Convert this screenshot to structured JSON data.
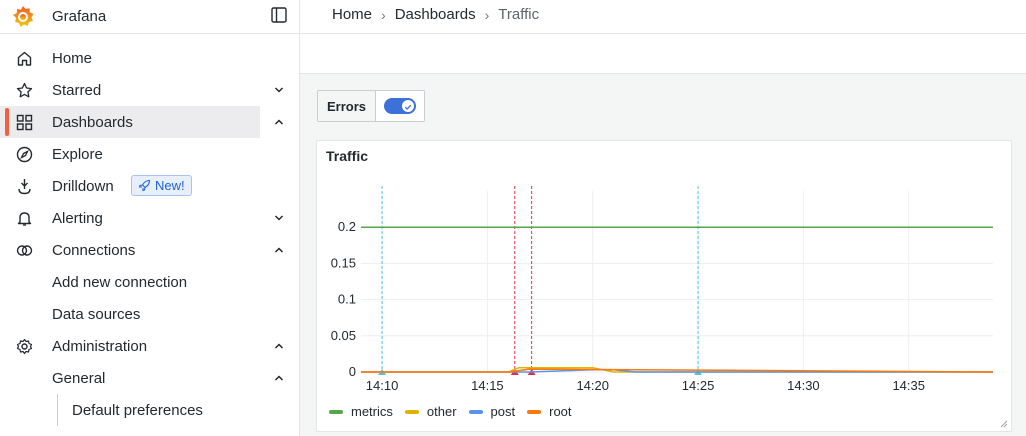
{
  "app": {
    "title": "Grafana"
  },
  "sidebar": {
    "items": [
      {
        "label": "Home",
        "icon": "home-icon"
      },
      {
        "label": "Starred",
        "icon": "star-icon",
        "chevron": "down"
      },
      {
        "label": "Dashboards",
        "icon": "apps-icon",
        "chevron": "up",
        "active": true
      },
      {
        "label": "Explore",
        "icon": "compass-icon"
      },
      {
        "label": "Drilldown",
        "icon": "drilldown-icon",
        "badge": "New!"
      },
      {
        "label": "Alerting",
        "icon": "bell-icon",
        "chevron": "down"
      },
      {
        "label": "Connections",
        "icon": "connections-icon",
        "chevron": "up"
      },
      {
        "label": "Add new connection"
      },
      {
        "label": "Data sources"
      },
      {
        "label": "Administration",
        "icon": "cog-icon",
        "chevron": "up"
      },
      {
        "label": "General",
        "chevron": "up"
      },
      {
        "label": "Default preferences"
      }
    ]
  },
  "breadcrumb": {
    "items": [
      "Home",
      "Dashboards",
      "Traffic"
    ]
  },
  "variable": {
    "label": "Errors",
    "enabled": true
  },
  "panel": {
    "title": "Traffic"
  },
  "colors": {
    "accent": "#f55f3e",
    "metrics": "#56a64b",
    "other": "#e0b400",
    "post": "#5794f2",
    "root": "#ff780a",
    "annotation_blue": "#4fc4e0",
    "annotation_red": "#e02f44"
  },
  "chart_data": {
    "type": "line",
    "title": "Traffic",
    "xlabel": "",
    "ylabel": "",
    "x_ticks": [
      "14:10",
      "14:15",
      "14:20",
      "14:25",
      "14:30",
      "14:35"
    ],
    "y_ticks": [
      "0",
      "0.05",
      "0.1",
      "0.15",
      "0.2"
    ],
    "ylim": [
      0,
      0.25
    ],
    "xlim": [
      "14:09",
      "14:39"
    ],
    "legend_position": "bottom",
    "series": [
      {
        "name": "metrics",
        "x": [
          "14:09",
          "14:39"
        ],
        "y": [
          0.2,
          0.2
        ]
      },
      {
        "name": "other",
        "x": [
          "14:09",
          "14:16",
          "14:16.5",
          "14:20",
          "14:21",
          "14:39"
        ],
        "y": [
          0,
          0,
          0.006,
          0.006,
          0,
          0
        ]
      },
      {
        "name": "post",
        "x": [
          "14:09",
          "14:17",
          "14:20",
          "14:21",
          "14:22",
          "14:39"
        ],
        "y": [
          0,
          0,
          0.003,
          0.003,
          0,
          0
        ]
      },
      {
        "name": "root",
        "x": [
          "14:09",
          "14:16",
          "14:17",
          "14:39"
        ],
        "y": [
          0,
          0,
          0.004,
          0
        ]
      }
    ],
    "annotations": [
      {
        "x": "14:10",
        "color": "blue"
      },
      {
        "x": "14:16.3",
        "color": "red"
      },
      {
        "x": "14:17.1",
        "color": "red"
      },
      {
        "x": "14:25",
        "color": "blue"
      }
    ]
  }
}
